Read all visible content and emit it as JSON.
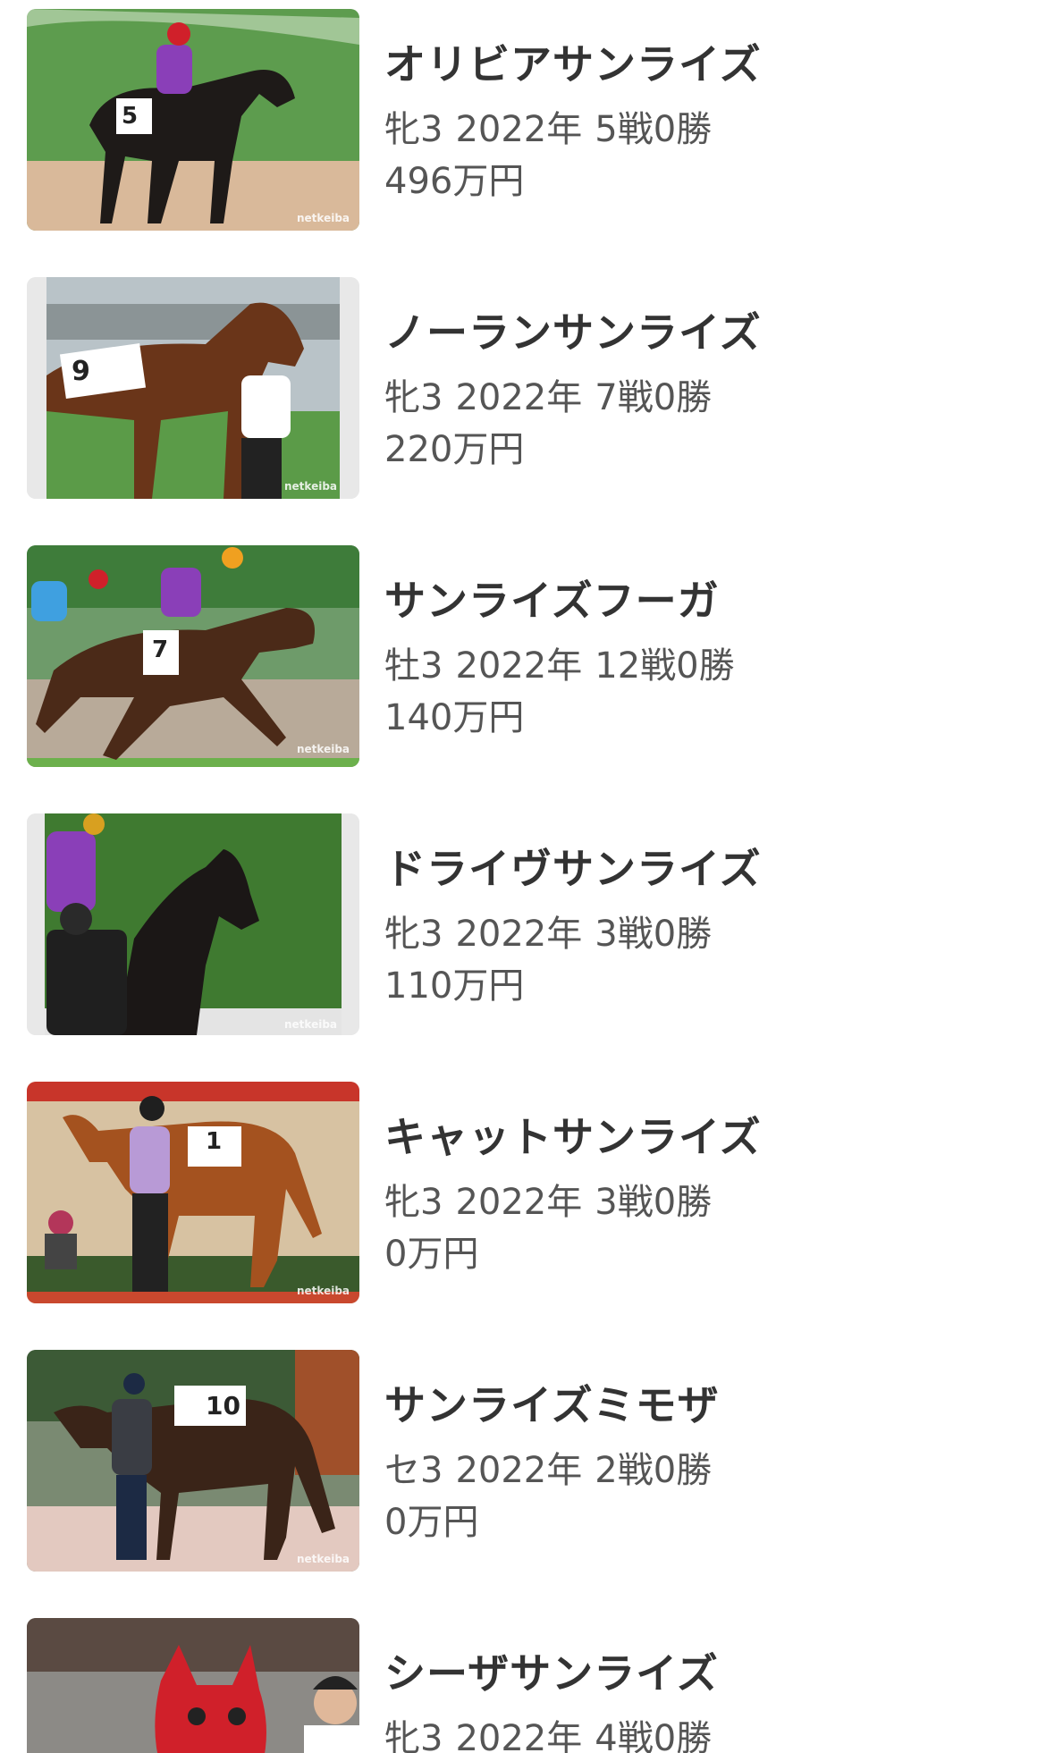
{
  "horses": [
    {
      "name": "オリビアサンライズ",
      "sex_age": "牝3",
      "year": "2022年",
      "record": "5戦0勝",
      "prize": "496万円",
      "photo_credit": "netkeiba",
      "number": "5",
      "silks_color": "#8a3fb8"
    },
    {
      "name": "ノーランサンライズ",
      "sex_age": "牝3",
      "year": "2022年",
      "record": "7戦0勝",
      "prize": "220万円",
      "photo_credit": "netkeiba",
      "number": "9",
      "silks_color": "#ffffff"
    },
    {
      "name": "サンライズフーガ",
      "sex_age": "牡3",
      "year": "2022年",
      "record": "12戦0勝",
      "prize": "140万円",
      "photo_credit": "netkeiba",
      "number": "7",
      "silks_color": "#8a3fb8"
    },
    {
      "name": "ドライヴサンライズ",
      "sex_age": "牝3",
      "year": "2022年",
      "record": "3戦0勝",
      "prize": "110万円",
      "photo_credit": "netkeiba",
      "number": "",
      "silks_color": "#8a3fb8"
    },
    {
      "name": "キャットサンライズ",
      "sex_age": "牝3",
      "year": "2022年",
      "record": "3戦0勝",
      "prize": "0万円",
      "photo_credit": "netkeiba",
      "number": "1",
      "silks_color": "#b89ad6"
    },
    {
      "name": "サンライズミモザ",
      "sex_age": "セ3",
      "year": "2022年",
      "record": "2戦0勝",
      "prize": "0万円",
      "photo_credit": "netkeiba",
      "number": "10",
      "silks_color": "#ffffff"
    },
    {
      "name": "シーザサンライズ",
      "sex_age": "牝3",
      "year": "2022年",
      "record": "4戦0勝",
      "prize": "",
      "photo_credit": "",
      "number": "",
      "silks_color": "#d0202a"
    }
  ]
}
